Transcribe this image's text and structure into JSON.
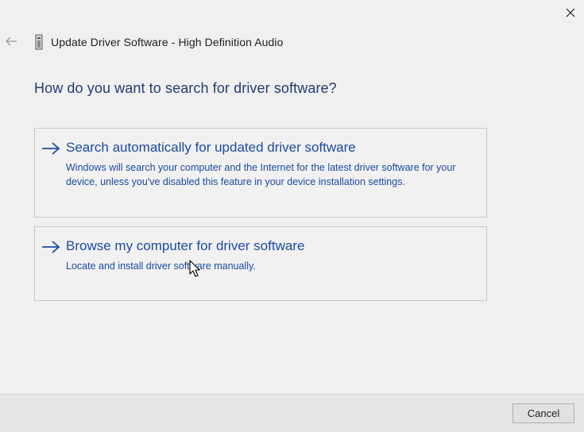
{
  "window": {
    "title": "Update Driver Software - High Definition Audio",
    "icons": {
      "close": "close-icon",
      "back": "back-arrow-icon",
      "device": "audio-device-icon"
    }
  },
  "main": {
    "heading": "How do you want to search for driver software?",
    "options": [
      {
        "title": "Search automatically for updated driver software",
        "description": "Windows will search your computer and the Internet for the latest driver software for your device, unless you've disabled this feature in your device installation settings.",
        "icon": "arrow-right-icon"
      },
      {
        "title": "Browse my computer for driver software",
        "description": "Locate and install driver software manually.",
        "icon": "arrow-right-icon"
      }
    ]
  },
  "footer": {
    "cancel_label": "Cancel"
  },
  "colors": {
    "background": "#f0f0f0",
    "heading": "#1f3d73",
    "link": "#1d4aa1",
    "border": "#c9c9c9"
  }
}
